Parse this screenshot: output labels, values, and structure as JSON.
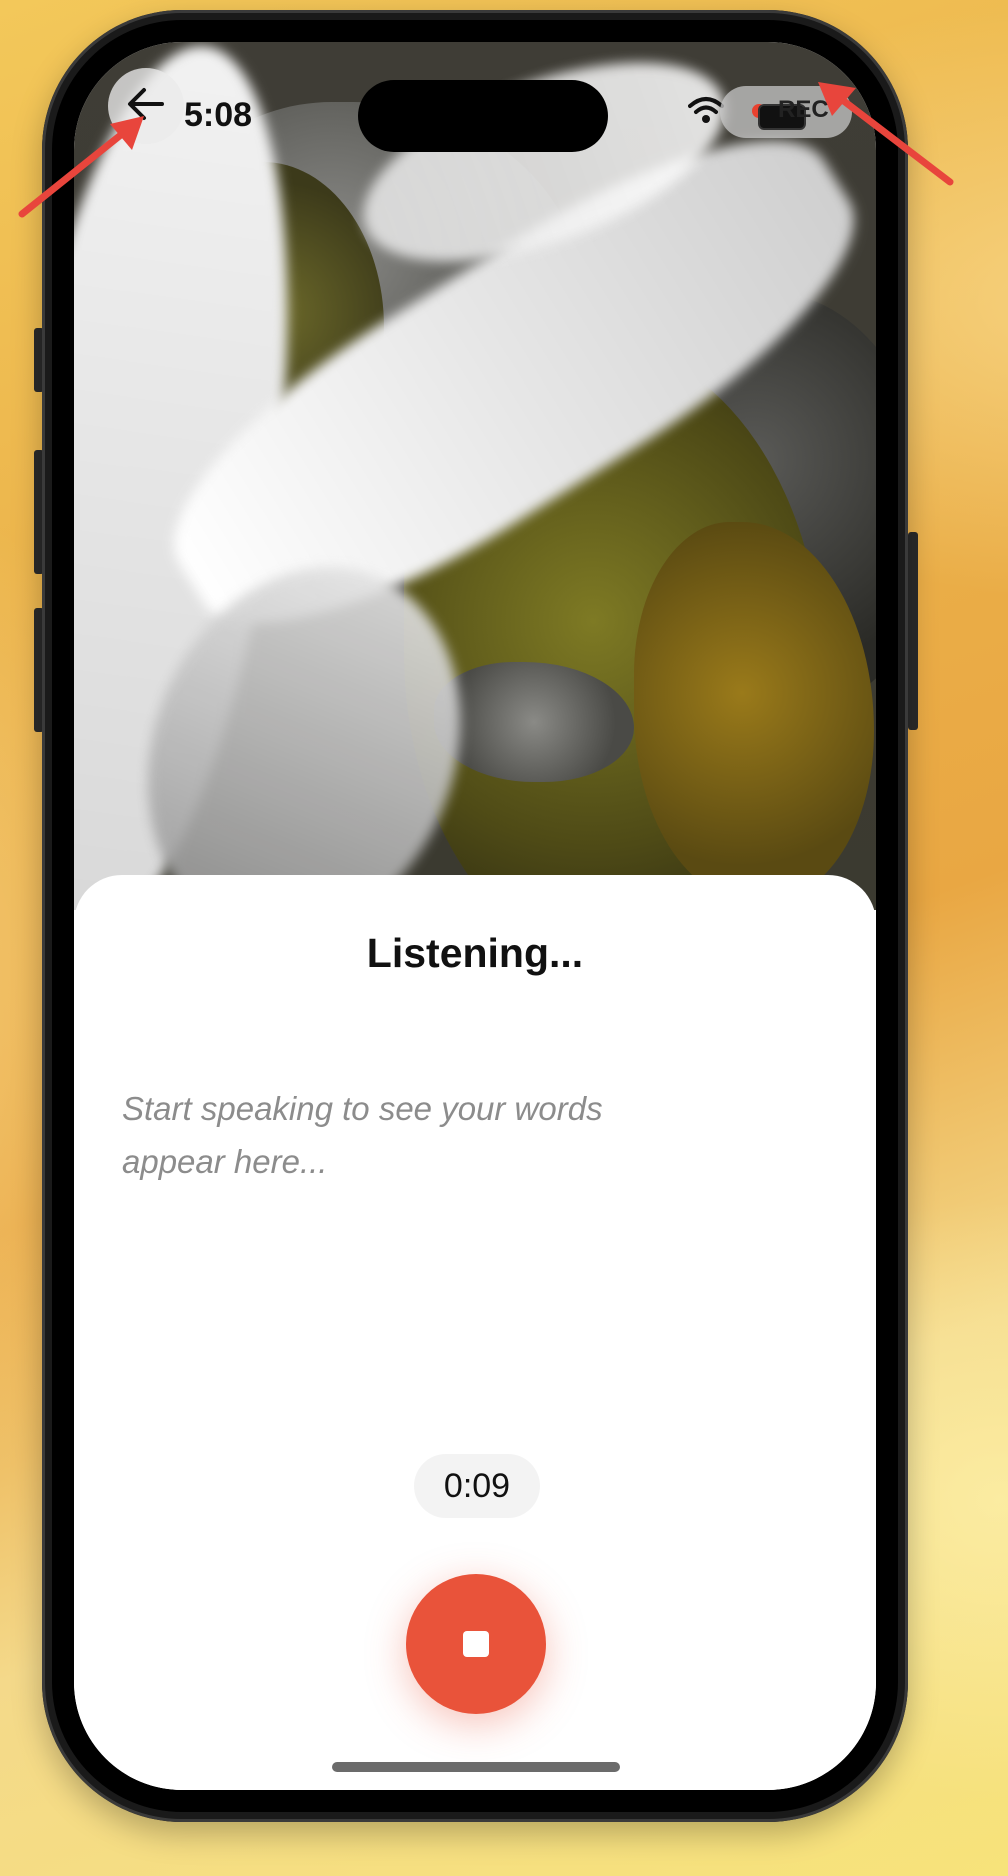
{
  "status_bar": {
    "time": "5:08",
    "rec_label": "REC"
  },
  "navigation": {
    "back_icon": "arrow-left-icon"
  },
  "sheet": {
    "title": "Listening...",
    "placeholder": "Start speaking to see your words appear here..."
  },
  "recording": {
    "elapsed": "0:09",
    "stop_icon": "stop-icon"
  },
  "colors": {
    "accent": "#e9533a",
    "annotation_arrow": "#e8453c",
    "background": "#f0c25a"
  }
}
